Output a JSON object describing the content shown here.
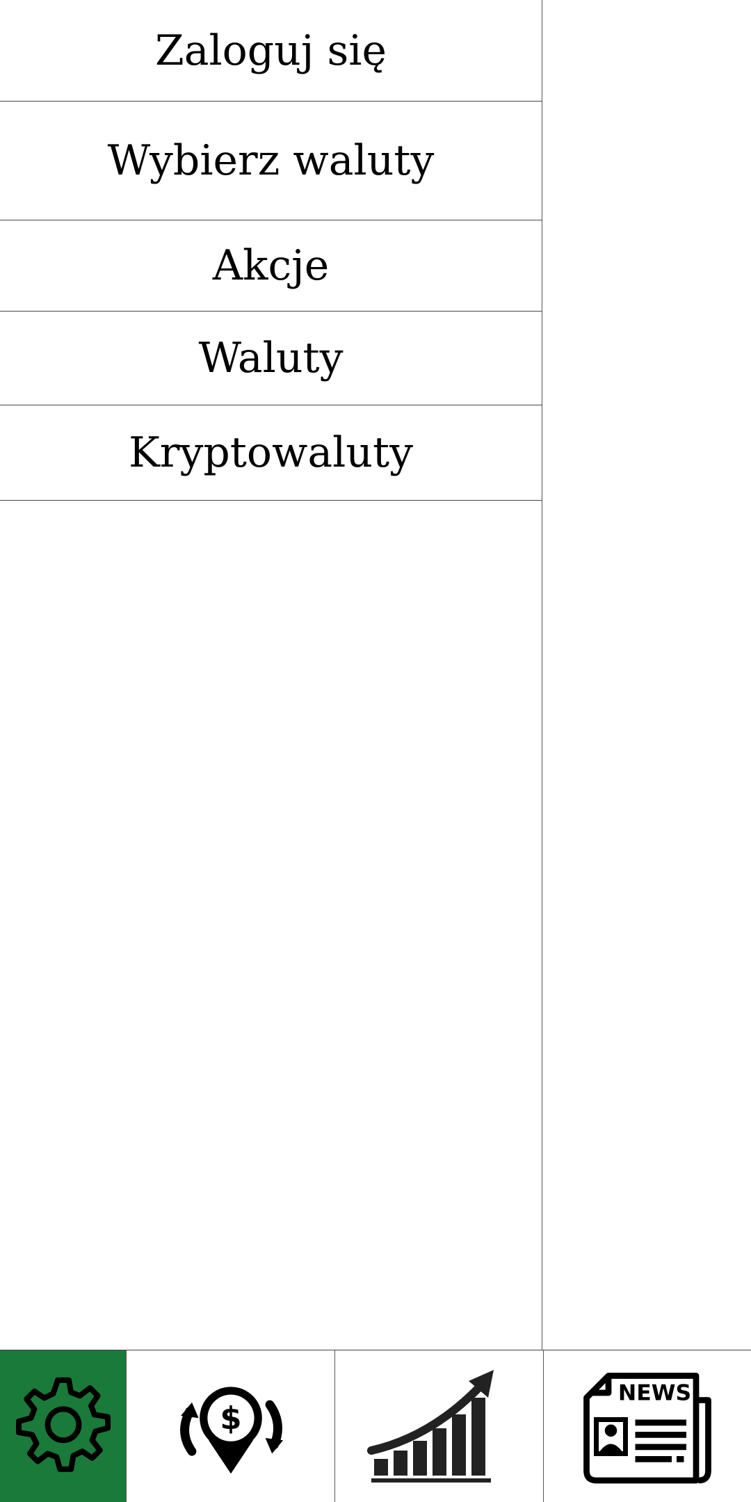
{
  "menu": {
    "items": [
      {
        "label": "Zaloguj się"
      },
      {
        "label": "Wybierz waluty"
      },
      {
        "label": "Akcje"
      },
      {
        "label": "Waluty"
      },
      {
        "label": "Kryptowaluty"
      }
    ]
  },
  "bottom_nav": {
    "items": [
      {
        "icon": "gear-icon",
        "active": true
      },
      {
        "icon": "currency-exchange-icon",
        "active": false
      },
      {
        "icon": "growth-chart-icon",
        "active": false
      },
      {
        "icon": "newspaper-icon",
        "active": false
      }
    ],
    "news_icon_text": "NEWS"
  },
  "colors": {
    "active_tab": "#1a7a3a",
    "divider": "#444444",
    "text": "#000000",
    "icon": "#000000",
    "background": "#ffffff"
  }
}
